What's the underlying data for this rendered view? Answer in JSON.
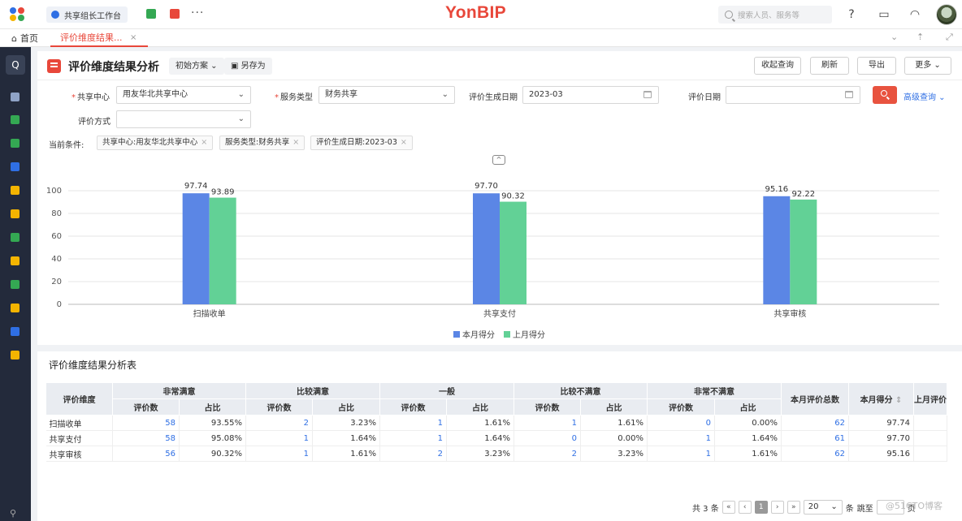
{
  "topbar": {
    "workspace_tab": "共享组长工作台",
    "more": "···",
    "brand": "YonBIP",
    "search_placeholder": "搜索人员、服务等"
  },
  "tabs": {
    "home": "首页",
    "active": "评价维度结果...",
    "close": "×"
  },
  "page": {
    "title": "评价维度结果分析",
    "scheme": "初始方案",
    "save_as": "另存为",
    "buttons": {
      "collapse_query": "收起查询",
      "refresh": "刷新",
      "export": "导出",
      "more": "更多"
    }
  },
  "filters": {
    "share_center_label": "共享中心",
    "share_center_value": "用友华北共享中心",
    "service_type_label": "服务类型",
    "service_type_value": "财务共享",
    "gen_date_label": "评价生成日期",
    "gen_date_value": "2023-03",
    "eval_date_label": "评价日期",
    "eval_date_value": "",
    "eval_method_label": "评价方式",
    "eval_method_value": "",
    "advanced": "高级查询",
    "conditions_label": "当前条件:",
    "conditions": [
      "共享中心:用友华北共享中心",
      "服务类型:财务共享",
      "评价生成日期:2023-03"
    ]
  },
  "chart_data": {
    "type": "bar",
    "categories": [
      "扫描收单",
      "共享支付",
      "共享审核"
    ],
    "series": [
      {
        "name": "本月得分",
        "values": [
          97.74,
          97.7,
          95.16
        ],
        "color": "#5b86e5"
      },
      {
        "name": "上月得分",
        "values": [
          93.89,
          90.32,
          92.22
        ],
        "color": "#62d196"
      }
    ],
    "ylim": [
      0,
      100
    ],
    "yticks": [
      0,
      20,
      40,
      60,
      80,
      100
    ],
    "grid": true,
    "legend": "bottom"
  },
  "table": {
    "title": "评价维度结果分析表",
    "dim_header": "评价维度",
    "groups": [
      "非常满意",
      "比较满意",
      "一般",
      "比较不满意",
      "非常不满意"
    ],
    "sub_count": "评价数",
    "sub_ratio": "占比",
    "total_header": "本月评价总数",
    "score_header": "本月得分",
    "last_header": "上月评价",
    "rows": [
      {
        "name": "扫描收单",
        "c1": "58",
        "r1": "93.55%",
        "c2": "2",
        "r2": "3.23%",
        "c3": "1",
        "r3": "1.61%",
        "c4": "1",
        "r4": "1.61%",
        "c5": "0",
        "r5": "0.00%",
        "total": "62",
        "score": "97.74"
      },
      {
        "name": "共享支付",
        "c1": "58",
        "r1": "95.08%",
        "c2": "1",
        "r2": "1.64%",
        "c3": "1",
        "r3": "1.64%",
        "c4": "0",
        "r4": "0.00%",
        "c5": "1",
        "r5": "1.64%",
        "total": "61",
        "score": "97.70"
      },
      {
        "name": "共享审核",
        "c1": "56",
        "r1": "90.32%",
        "c2": "1",
        "r2": "1.61%",
        "c3": "2",
        "r3": "3.23%",
        "c4": "2",
        "r4": "3.23%",
        "c5": "1",
        "r5": "1.61%",
        "total": "62",
        "score": "95.16"
      }
    ]
  },
  "pager": {
    "total": "共 3 条",
    "page": "1",
    "page_size": "20",
    "unit": "条",
    "jump": "跳至",
    "page_word": "页"
  },
  "watermark": "@51CTO博客"
}
